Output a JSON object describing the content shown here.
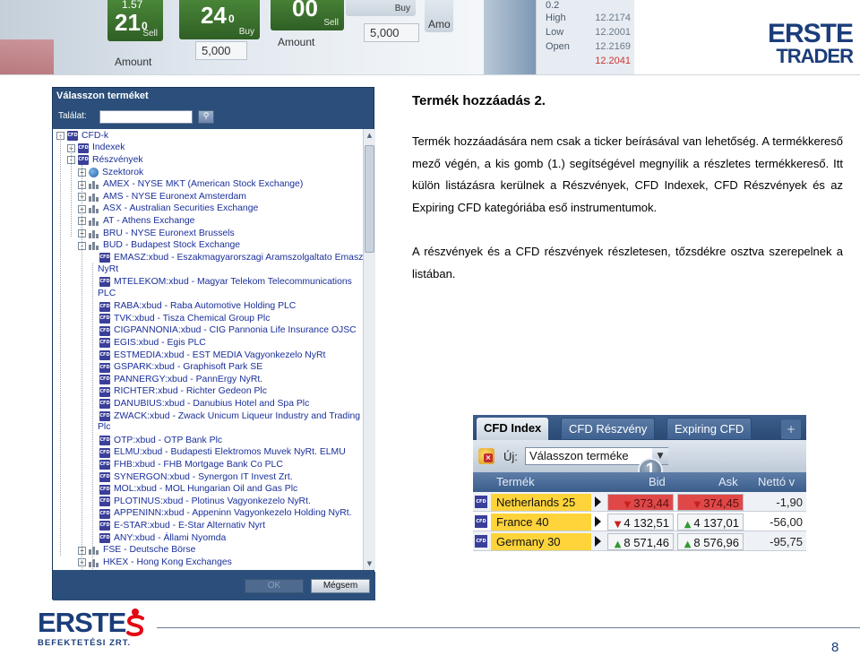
{
  "banner": {
    "tiles": [
      {
        "big": "21",
        "small": "0",
        "label": "Sell",
        "top_value": "1.57"
      },
      {
        "big": "24",
        "small": "0",
        "label": "Buy"
      },
      {
        "big": "00",
        "small": "",
        "label": "Sell"
      },
      {
        "big": "",
        "small": "",
        "label": "Buy"
      }
    ],
    "amount_label": "Amount",
    "amount_values": [
      "5,000",
      "5,000"
    ],
    "quotes": [
      {
        "label": "High",
        "value": "12.2174"
      },
      {
        "label": "Low",
        "value": "12.2001"
      },
      {
        "label": "Open",
        "value": "12.2169"
      },
      {
        "label": "",
        "value": "12.2041"
      }
    ],
    "logo": {
      "line1": "ERSTE",
      "line2": "TRADER"
    }
  },
  "dialog": {
    "title": "Válasszon terméket",
    "search_label": "Találat:",
    "search_value": "",
    "ok_label": "OK",
    "cancel_label": "Mégsem",
    "tree": [
      {
        "level": 0,
        "expander": "-",
        "icon": "cfd",
        "label": "CFD-k"
      },
      {
        "level": 1,
        "expander": "+",
        "icon": "cfd",
        "label": "Indexek"
      },
      {
        "level": 1,
        "expander": "-",
        "icon": "cfd",
        "label": "Részvények"
      },
      {
        "level": 2,
        "expander": "+",
        "icon": "globe",
        "label": "Szektorok"
      },
      {
        "level": 2,
        "expander": "+",
        "icon": "exchange",
        "label": "AMEX - NYSE MKT (American Stock Exchange)"
      },
      {
        "level": 2,
        "expander": "+",
        "icon": "exchange",
        "label": "AMS - NYSE Euronext Amsterdam"
      },
      {
        "level": 2,
        "expander": "+",
        "icon": "exchange",
        "label": "ASX - Australian Securities Exchange"
      },
      {
        "level": 2,
        "expander": "+",
        "icon": "exchange",
        "label": "AT - Athens Exchange"
      },
      {
        "level": 2,
        "expander": "+",
        "icon": "exchange",
        "label": "BRU - NYSE Euronext Brussels"
      },
      {
        "level": 2,
        "expander": "-",
        "icon": "exchange",
        "label": "BUD - Budapest Stock Exchange"
      },
      {
        "level": 3,
        "expander": "",
        "icon": "cfd",
        "label": "EMASZ:xbud - Eszakmagyarorszagi Aramszolgaltato Emasz",
        "wrap": "NyRt"
      },
      {
        "level": 3,
        "expander": "",
        "icon": "cfd",
        "label": "MTELEKOM:xbud - Magyar Telekom Telecommunications",
        "wrap": "PLC"
      },
      {
        "level": 3,
        "expander": "",
        "icon": "cfd",
        "label": "RABA:xbud - Raba Automotive Holding PLC"
      },
      {
        "level": 3,
        "expander": "",
        "icon": "cfd",
        "label": "TVK:xbud - Tisza Chemical Group Plc"
      },
      {
        "level": 3,
        "expander": "",
        "icon": "cfd",
        "label": "CIGPANNONIA:xbud - CIG Pannonia Life Insurance OJSC"
      },
      {
        "level": 3,
        "expander": "",
        "icon": "cfd",
        "label": "EGIS:xbud - Egis PLC"
      },
      {
        "level": 3,
        "expander": "",
        "icon": "cfd",
        "label": "ESTMEDIA:xbud - EST MEDIA Vagyonkezelo NyRt"
      },
      {
        "level": 3,
        "expander": "",
        "icon": "cfd",
        "label": "GSPARK:xbud - Graphisoft Park SE"
      },
      {
        "level": 3,
        "expander": "",
        "icon": "cfd",
        "label": "PANNERGY:xbud - PannErgy NyRt."
      },
      {
        "level": 3,
        "expander": "",
        "icon": "cfd",
        "label": "RICHTER:xbud - Richter Gedeon Plc"
      },
      {
        "level": 3,
        "expander": "",
        "icon": "cfd",
        "label": "DANUBIUS:xbud - Danubius Hotel and Spa Plc"
      },
      {
        "level": 3,
        "expander": "",
        "icon": "cfd",
        "label": "ZWACK:xbud - Zwack Unicum Liqueur Industry and Trading",
        "wrap": "Plc"
      },
      {
        "level": 3,
        "expander": "",
        "icon": "cfd",
        "label": "OTP:xbud - OTP Bank Plc"
      },
      {
        "level": 3,
        "expander": "",
        "icon": "cfd",
        "label": "ELMU:xbud - Budapesti Elektromos Muvek NyRt. ELMU"
      },
      {
        "level": 3,
        "expander": "",
        "icon": "cfd",
        "label": "FHB:xbud - FHB Mortgage Bank Co PLC"
      },
      {
        "level": 3,
        "expander": "",
        "icon": "cfd",
        "label": "SYNERGON:xbud - Synergon IT Invest Zrt."
      },
      {
        "level": 3,
        "expander": "",
        "icon": "cfd",
        "label": "MOL:xbud - MOL Hungarian Oil and Gas Plc"
      },
      {
        "level": 3,
        "expander": "",
        "icon": "cfd",
        "label": "PLOTINUS:xbud - Plotinus Vagyonkezelo NyRt."
      },
      {
        "level": 3,
        "expander": "",
        "icon": "cfd",
        "label": "APPENINN:xbud - Appeninn Vagyonkezelo Holding NyRt."
      },
      {
        "level": 3,
        "expander": "",
        "icon": "cfd",
        "label": "E-STAR:xbud - E-Star Alternativ Nyrt"
      },
      {
        "level": 3,
        "expander": "",
        "icon": "cfd",
        "label": "ANY:xbud - Állami Nyomda"
      },
      {
        "level": 2,
        "expander": "+",
        "icon": "exchange",
        "label": "FSE - Deutsche Börse"
      },
      {
        "level": 2,
        "expander": "+",
        "icon": "exchange",
        "label": "HKEX - Hong Kong Exchanges"
      }
    ]
  },
  "content": {
    "heading": "Termék hozzáadás 2.",
    "para1": "Termék hozzáadására nem csak a ticker beírásával van lehetőség. A termékkereső mező végén, a kis gomb (1.) segítségével megnyílik a részletes termékkereső. Itt külön listázásra kerülnek a Részvények, CFD Indexek, CFD Részvények és az Expiring CFD kategóriába eső instrumentumok.",
    "para2": "A részvények és a CFD részvények részletesen, tőzsdékre osztva szerepelnek a listában."
  },
  "widget": {
    "tabs": [
      "CFD Index",
      "CFD Részvény",
      "Expiring CFD"
    ],
    "plus": "+",
    "new_label": "Új:",
    "select_value": "Válasszon terméke",
    "badge": "1",
    "columns": [
      "Termék",
      "Bid",
      "Ask",
      "Nettó v"
    ],
    "rows": [
      {
        "name": "Netherlands 25",
        "bid": "373,44",
        "ask": "374,45",
        "net": "-1,90",
        "bid_dir": "down",
        "ask_dir": "down",
        "bid_bg": "red",
        "ask_bg": "red"
      },
      {
        "name": "France 40",
        "bid": "4 132,51",
        "ask": "4 137,01",
        "net": "-56,00",
        "bid_dir": "down",
        "ask_dir": "up",
        "bid_bg": "white",
        "ask_bg": "white"
      },
      {
        "name": "Germany 30",
        "bid": "8 571,46",
        "ask": "8 576,96",
        "net": "-95,75",
        "bid_dir": "up",
        "ask_dir": "up",
        "bid_bg": "white",
        "ask_bg": "white"
      }
    ]
  },
  "footer": {
    "logo_line1": "ERSTE",
    "logo_line2": "BEFEKTETÉSI ZRT.",
    "page_number": "8"
  },
  "colors": {
    "brand_blue": "#1b3d7a",
    "brand_red": "#e30613",
    "dialog_blue": "#2b4f7a",
    "tree_text": "#1a2f9a",
    "highlight_yellow": "#ffd43b"
  }
}
